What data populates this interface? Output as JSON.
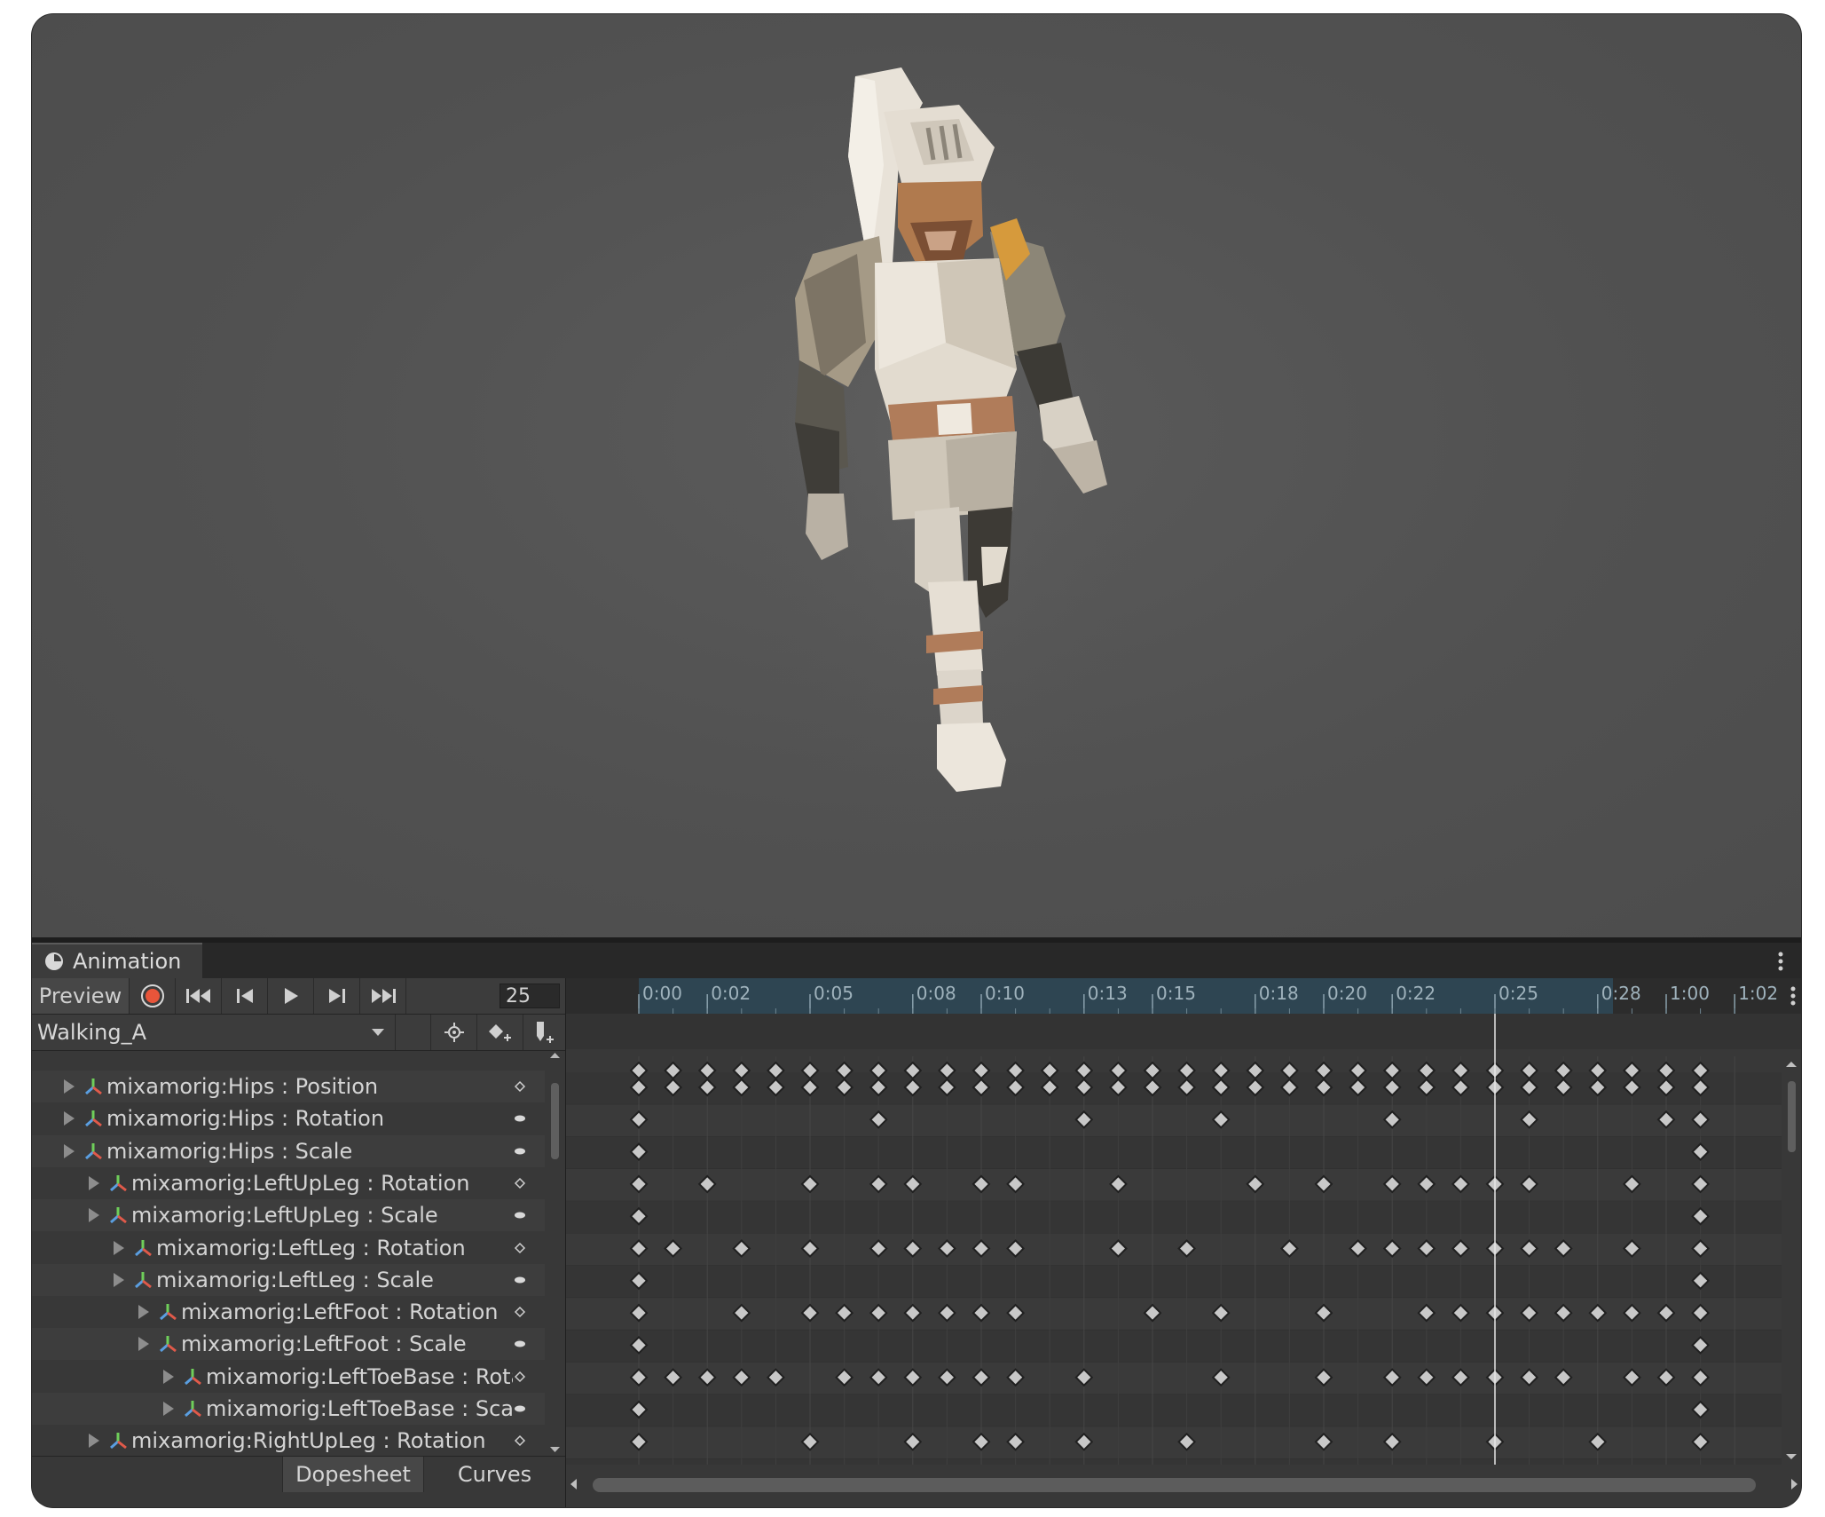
{
  "window": {
    "tab_title": "Animation"
  },
  "toolbar": {
    "preview_label": "Preview",
    "frame_value": "25",
    "clip_name": "Walking_A",
    "buttons": [
      {
        "name": "record-button",
        "icon": "record-icon"
      },
      {
        "name": "first-key-button",
        "icon": "skip-to-start-icon"
      },
      {
        "name": "prev-key-button",
        "icon": "step-back-icon"
      },
      {
        "name": "play-button",
        "icon": "play-icon"
      },
      {
        "name": "next-key-button",
        "icon": "step-forward-icon"
      },
      {
        "name": "last-key-button",
        "icon": "skip-to-end-icon"
      }
    ],
    "tool_icons": [
      "filter-by-selection-icon",
      "add-keyframe-icon",
      "add-event-icon"
    ]
  },
  "timeline": {
    "tick_labels": [
      "0:00",
      "0:02",
      "0:05",
      "0:08",
      "0:10",
      "0:13",
      "0:15",
      "0:18",
      "0:20",
      "0:22",
      "0:25",
      "0:28",
      "1:00",
      "1:02"
    ],
    "playhead_frame": 25
  },
  "properties": [
    {
      "label": "mixamorig:Hips : Position",
      "indent": 1,
      "key_icon": "diamond"
    },
    {
      "label": "mixamorig:Hips : Rotation",
      "indent": 1,
      "key_icon": "oval"
    },
    {
      "label": "mixamorig:Hips : Scale",
      "indent": 1,
      "key_icon": "oval"
    },
    {
      "label": "mixamorig:LeftUpLeg : Rotation",
      "indent": 2,
      "key_icon": "diamond"
    },
    {
      "label": "mixamorig:LeftUpLeg : Scale",
      "indent": 2,
      "key_icon": "oval"
    },
    {
      "label": "mixamorig:LeftLeg : Rotation",
      "indent": 3,
      "key_icon": "diamond"
    },
    {
      "label": "mixamorig:LeftLeg : Scale",
      "indent": 3,
      "key_icon": "oval"
    },
    {
      "label": "mixamorig:LeftFoot : Rotation",
      "indent": 4,
      "key_icon": "diamond"
    },
    {
      "label": "mixamorig:LeftFoot : Scale",
      "indent": 4,
      "key_icon": "oval"
    },
    {
      "label": "mixamorig:LeftToeBase : Rotation",
      "indent": 5,
      "key_icon": "diamond"
    },
    {
      "label": "mixamorig:LeftToeBase : Scale",
      "indent": 5,
      "key_icon": "oval"
    },
    {
      "label": "mixamorig:RightUpLeg : Rotation",
      "indent": 2,
      "key_icon": "diamond"
    }
  ],
  "keyframes": {
    "summary": [
      0,
      1,
      2,
      3,
      4,
      5,
      6,
      7,
      8,
      9,
      10,
      11,
      12,
      13,
      14,
      15,
      16,
      17,
      18,
      19,
      20,
      21,
      22,
      23,
      24,
      25,
      26,
      27,
      28,
      29,
      30,
      31
    ],
    "rows": [
      [
        0,
        1,
        2,
        3,
        4,
        5,
        6,
        7,
        8,
        9,
        10,
        11,
        12,
        13,
        14,
        15,
        16,
        17,
        18,
        19,
        20,
        21,
        22,
        23,
        24,
        25,
        26,
        27,
        28,
        29,
        30,
        31
      ],
      [
        0,
        7,
        13,
        17,
        22,
        26,
        30,
        31
      ],
      [
        0,
        31
      ],
      [
        0,
        2,
        5,
        7,
        8,
        10,
        11,
        14,
        18,
        20,
        22,
        23,
        24,
        25,
        26,
        29,
        31
      ],
      [
        0,
        31
      ],
      [
        0,
        1,
        3,
        5,
        7,
        8,
        9,
        10,
        11,
        14,
        16,
        19,
        21,
        22,
        23,
        24,
        25,
        26,
        27,
        29,
        31
      ],
      [
        0,
        31
      ],
      [
        0,
        3,
        5,
        6,
        7,
        8,
        9,
        10,
        11,
        15,
        17,
        20,
        23,
        24,
        25,
        26,
        27,
        28,
        29,
        30,
        31
      ],
      [
        0,
        31
      ],
      [
        0,
        1,
        2,
        3,
        4,
        6,
        7,
        8,
        9,
        10,
        11,
        13,
        17,
        20,
        22,
        23,
        24,
        25,
        26,
        27,
        29,
        30,
        31
      ],
      [
        0,
        31
      ],
      [
        0,
        5,
        8,
        10,
        11,
        13,
        16,
        20,
        22,
        25,
        28,
        31
      ]
    ]
  },
  "bottom_tabs": {
    "dopesheet_label": "Dopesheet",
    "curves_label": "Curves"
  },
  "colors": {
    "record": "#e8553a",
    "ruler_blue": "#2e4552",
    "keyframe": "#c8c8c8",
    "panel": "#383838"
  }
}
